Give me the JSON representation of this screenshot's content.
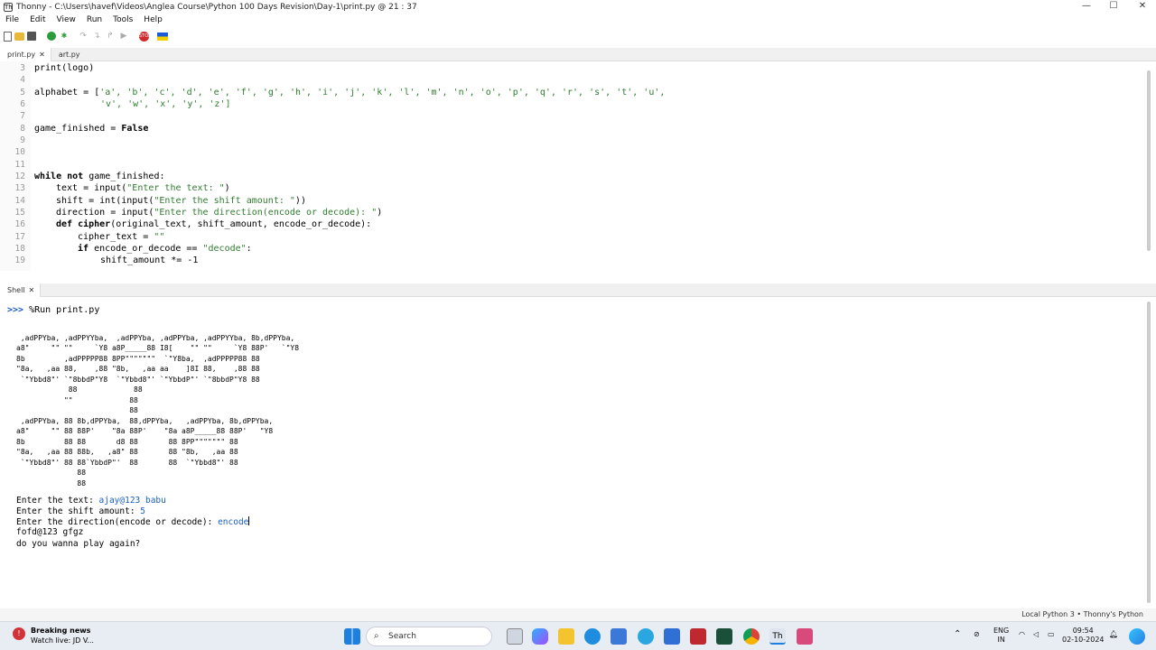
{
  "window": {
    "title": "Thonny  -  C:\\Users\\havef\\Videos\\Anglea Course\\Python 100 Days Revision\\Day-1\\print.py  @  21 : 37",
    "app_icon": "Th",
    "minimize": "—",
    "maximize": "☐",
    "close": "✕"
  },
  "menu": [
    "File",
    "Edit",
    "View",
    "Run",
    "Tools",
    "Help"
  ],
  "toolbar": {
    "icons": [
      "new-file-icon",
      "open-file-icon",
      "save-icon",
      "run-icon",
      "debug-icon",
      "step-over-icon",
      "step-into-icon",
      "step-out-icon",
      "resume-icon",
      "stop-icon",
      "flag-icon"
    ]
  },
  "editor_tabs": [
    {
      "label": "print.py",
      "close": "✕"
    },
    {
      "label": "art.py"
    }
  ],
  "editor": {
    "line_numbers": [
      "3",
      "4",
      "5",
      "6",
      "7",
      "8",
      "9",
      "10",
      "11",
      "12",
      "13",
      "14",
      "15",
      "16",
      "17",
      "18",
      "19"
    ],
    "lines": {
      "l3": "print(logo)",
      "l5a": "alphabet = [",
      "l5b": "'a', 'b', 'c', 'd', 'e', 'f', 'g', 'h', 'i', 'j', 'k', 'l', 'm', 'n', 'o', 'p', 'q', 'r', 's', 't', 'u',",
      "l6": "'v', 'w', 'x', 'y', 'z']",
      "l8a": "game_finished = ",
      "l8b": "False",
      "l12a": "while not",
      "l12b": " game_finished:",
      "l13a": "text = input(",
      "l13b": "\"Enter the text: \"",
      "l13c": ")",
      "l14a": "shift = int(input(",
      "l14b": "\"Enter the shift amount: \"",
      "l14c": "))",
      "l15a": "direction = input(",
      "l15b": "\"Enter the direction(encode or decode): \"",
      "l15c": ")",
      "l16a": "def",
      "l16b": " cipher",
      "l16c": "(original_text, shift_amount, encode_or_decode):",
      "l17a": "cipher_text = ",
      "l17b": "\"\"",
      "l18a": "if",
      "l18b": " encode_or_decode == ",
      "l18c": "\"decode\"",
      "l18d": ":",
      "l19": "shift_amount *= -1"
    }
  },
  "shell_tab": {
    "label": "Shell",
    "close": "✕"
  },
  "shell": {
    "prompt": ">>>",
    "command": " %Run print.py",
    "ascii_art": [
      " ,adPPYba, ,adPPYYba,  ,adPPYba, ,adPPYba, ,adPPYYba, 8b,dPPYba,",
      "a8\"     \"\" \"\"     `Y8 a8P_____88 I8[    \"\" \"\"     `Y8 88P'   `\"Y8",
      "8b         ,adPPPPP88 8PP\"\"\"\"\"\"\"  `\"Y8ba,  ,adPPPPP88 88",
      "\"8a,   ,aa 88,    ,88 \"8b,   ,aa aa    ]8I 88,    ,88 88",
      " `\"Ybbd8\"' `\"8bbdP\"Y8  `\"Ybbd8\"' `\"YbbdP\"' `\"8bbdP\"Y8 88",
      "            88             88",
      "           \"\"             88",
      "                          88",
      " ,adPPYba, 88 8b,dPPYba,  88,dPPYba,   ,adPPYba, 8b,dPPYba,",
      "a8\"     \"\" 88 88P'    \"8a 88P'    \"8a a8P_____88 88P'   \"Y8",
      "8b         88 88       d8 88       88 8PP\"\"\"\"\"\"\" 88",
      "\"8a,   ,aa 88 88b,   ,a8\" 88       88 \"8b,   ,aa 88",
      " `\"Ybbd8\"' 88 88`YbbdP\"'  88       88  `\"Ybbd8\"' 88",
      "              88",
      "              88"
    ],
    "out": {
      "text_prompt": "Enter the text: ",
      "text_value": "ajay@123 babu",
      "shift_prompt": "Enter the shift amount: ",
      "shift_value": "5",
      "dir_prompt": "Enter the direction(encode or decode): ",
      "dir_value": "encode",
      "result": "fofd@123 gfgz",
      "again": "do you wanna play again?"
    }
  },
  "statusbar": "Local Python 3  •  Thonny's Python",
  "taskbar": {
    "news_title": "Breaking news",
    "news_sub": "Watch live: JD V...",
    "search_placeholder": "Search",
    "lang_top": "ENG",
    "lang_bottom": "IN",
    "time": "09:54",
    "date": "02-10-2024",
    "app_icons": [
      "windows-start-icon",
      "taskview-icon",
      "copilot-icon",
      "file-explorer-icon",
      "edge-icon",
      "store-icon",
      "app-icon",
      "app-icon",
      "app-icon",
      "app-icon",
      "chrome-icon",
      "thonny-icon",
      "app-icon"
    ]
  }
}
